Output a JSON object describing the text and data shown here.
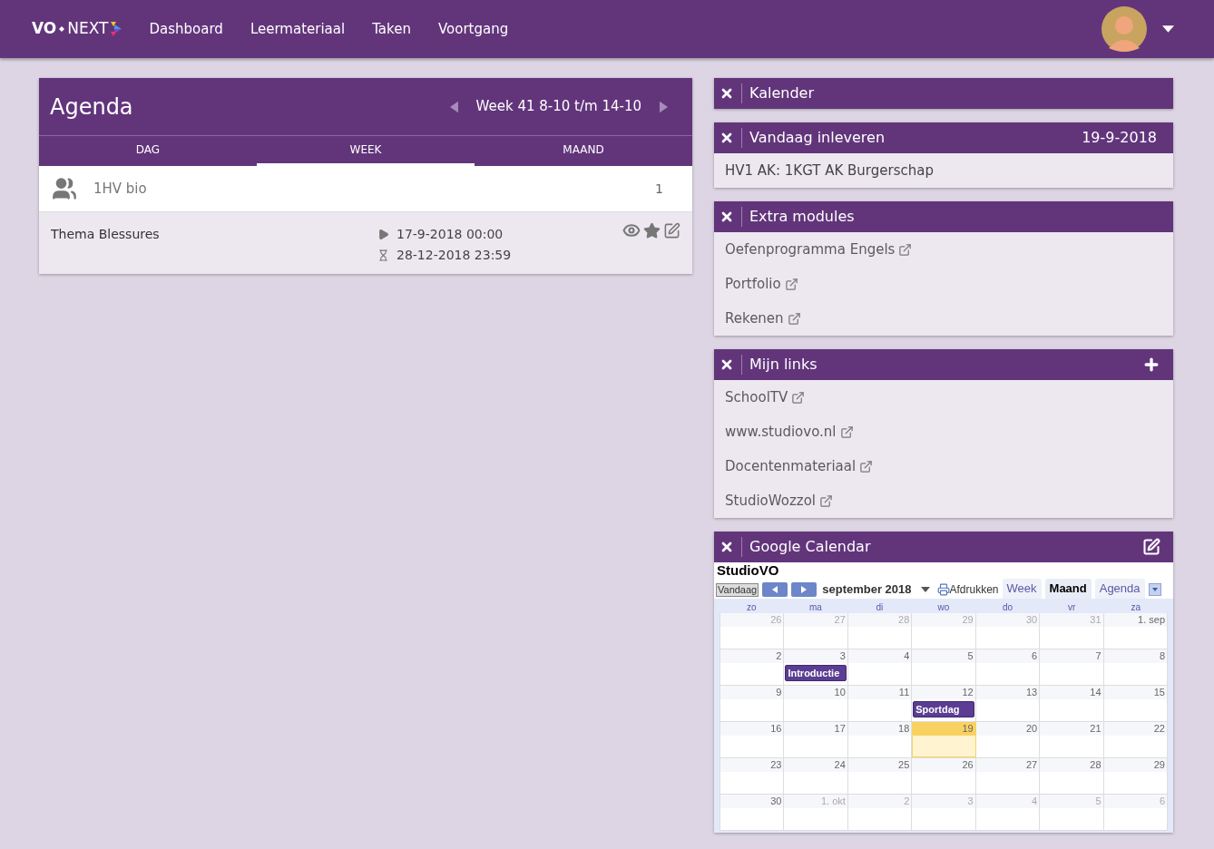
{
  "nav": {
    "logo_left": "VO",
    "logo_right": "NEXT",
    "items": [
      {
        "label": "Dashboard"
      },
      {
        "label": "Leermateriaal"
      },
      {
        "label": "Taken"
      },
      {
        "label": "Voortgang"
      }
    ]
  },
  "agenda": {
    "title": "Agenda",
    "week": "Week 41 8-10 t/m 14-10",
    "tabs": [
      {
        "label": "DAG",
        "selected": false
      },
      {
        "label": "WEEK",
        "selected": true
      },
      {
        "label": "MAAND",
        "selected": false
      }
    ],
    "group": {
      "name": "1HV bio",
      "count": "1"
    },
    "items": [
      {
        "title": "Thema Blessures",
        "start": "17-9-2018 00:00",
        "end": "28-12-2018 23:59"
      }
    ]
  },
  "widgets": [
    {
      "kind": "plain",
      "title": "Kalender"
    },
    {
      "kind": "list",
      "title": "Vandaag inleveren",
      "date": "19-9-2018",
      "items": [
        {
          "label": "HV1 AK: 1KGT AK Burgerschap",
          "external": false
        }
      ]
    },
    {
      "kind": "list",
      "title": "Extra modules",
      "items": [
        {
          "label": "Oefenprogramma Engels",
          "external": true
        },
        {
          "label": "Portfolio",
          "external": true
        },
        {
          "label": "Rekenen",
          "external": true
        }
      ]
    },
    {
      "kind": "list",
      "title": "Mijn links",
      "add": true,
      "items": [
        {
          "label": "SchoolTV",
          "external": true
        },
        {
          "label": "www.studiovo.nl",
          "external": true
        },
        {
          "label": "Docentenmateriaal",
          "external": true
        },
        {
          "label": "StudioWozzol",
          "external": true
        }
      ]
    },
    {
      "kind": "calendar",
      "title": "Google Calendar",
      "edit": true,
      "calendar": {
        "name": "StudioVO",
        "today_button": "Vandaag",
        "month": "september 2018",
        "print": "Afdrukken",
        "views": [
          {
            "label": "Week",
            "selected": false
          },
          {
            "label": "Maand",
            "selected": true
          },
          {
            "label": "Agenda",
            "selected": false
          }
        ],
        "weekdays": [
          "zo",
          "ma",
          "di",
          "wo",
          "do",
          "vr",
          "za"
        ],
        "weeks": [
          {
            "days": [
              {
                "label": "26",
                "other_month": true,
                "today": false
              },
              {
                "label": "27",
                "other_month": true,
                "today": false
              },
              {
                "label": "28",
                "other_month": true,
                "today": false
              },
              {
                "label": "29",
                "other_month": true,
                "today": false
              },
              {
                "label": "30",
                "other_month": true,
                "today": false
              },
              {
                "label": "31",
                "other_month": true,
                "today": false
              },
              {
                "label": "1. sep",
                "other_month": false,
                "today": false
              }
            ]
          },
          {
            "days": [
              {
                "label": "2",
                "other_month": false,
                "today": false
              },
              {
                "label": "3",
                "other_month": false,
                "today": false,
                "event": "Introductie"
              },
              {
                "label": "4",
                "other_month": false,
                "today": false
              },
              {
                "label": "5",
                "other_month": false,
                "today": false
              },
              {
                "label": "6",
                "other_month": false,
                "today": false
              },
              {
                "label": "7",
                "other_month": false,
                "today": false
              },
              {
                "label": "8",
                "other_month": false,
                "today": false
              }
            ]
          },
          {
            "days": [
              {
                "label": "9",
                "other_month": false,
                "today": false
              },
              {
                "label": "10",
                "other_month": false,
                "today": false
              },
              {
                "label": "11",
                "other_month": false,
                "today": false
              },
              {
                "label": "12",
                "other_month": false,
                "today": false,
                "event": "Sportdag"
              },
              {
                "label": "13",
                "other_month": false,
                "today": false
              },
              {
                "label": "14",
                "other_month": false,
                "today": false
              },
              {
                "label": "15",
                "other_month": false,
                "today": false
              }
            ]
          },
          {
            "days": [
              {
                "label": "16",
                "other_month": false,
                "today": false
              },
              {
                "label": "17",
                "other_month": false,
                "today": false
              },
              {
                "label": "18",
                "other_month": false,
                "today": false
              },
              {
                "label": "19",
                "other_month": false,
                "today": true
              },
              {
                "label": "20",
                "other_month": false,
                "today": false
              },
              {
                "label": "21",
                "other_month": false,
                "today": false
              },
              {
                "label": "22",
                "other_month": false,
                "today": false
              }
            ]
          },
          {
            "days": [
              {
                "label": "23",
                "other_month": false,
                "today": false
              },
              {
                "label": "24",
                "other_month": false,
                "today": false
              },
              {
                "label": "25",
                "other_month": false,
                "today": false
              },
              {
                "label": "26",
                "other_month": false,
                "today": false
              },
              {
                "label": "27",
                "other_month": false,
                "today": false
              },
              {
                "label": "28",
                "other_month": false,
                "today": false
              },
              {
                "label": "29",
                "other_month": false,
                "today": false
              }
            ]
          },
          {
            "days": [
              {
                "label": "30",
                "other_month": false,
                "today": false
              },
              {
                "label": "1. okt",
                "other_month": true,
                "today": false
              },
              {
                "label": "2",
                "other_month": true,
                "today": false
              },
              {
                "label": "3",
                "other_month": true,
                "today": false
              },
              {
                "label": "4",
                "other_month": true,
                "today": false
              },
              {
                "label": "5",
                "other_month": true,
                "today": false
              },
              {
                "label": "6",
                "other_month": true,
                "today": false
              }
            ]
          }
        ]
      }
    }
  ]
}
